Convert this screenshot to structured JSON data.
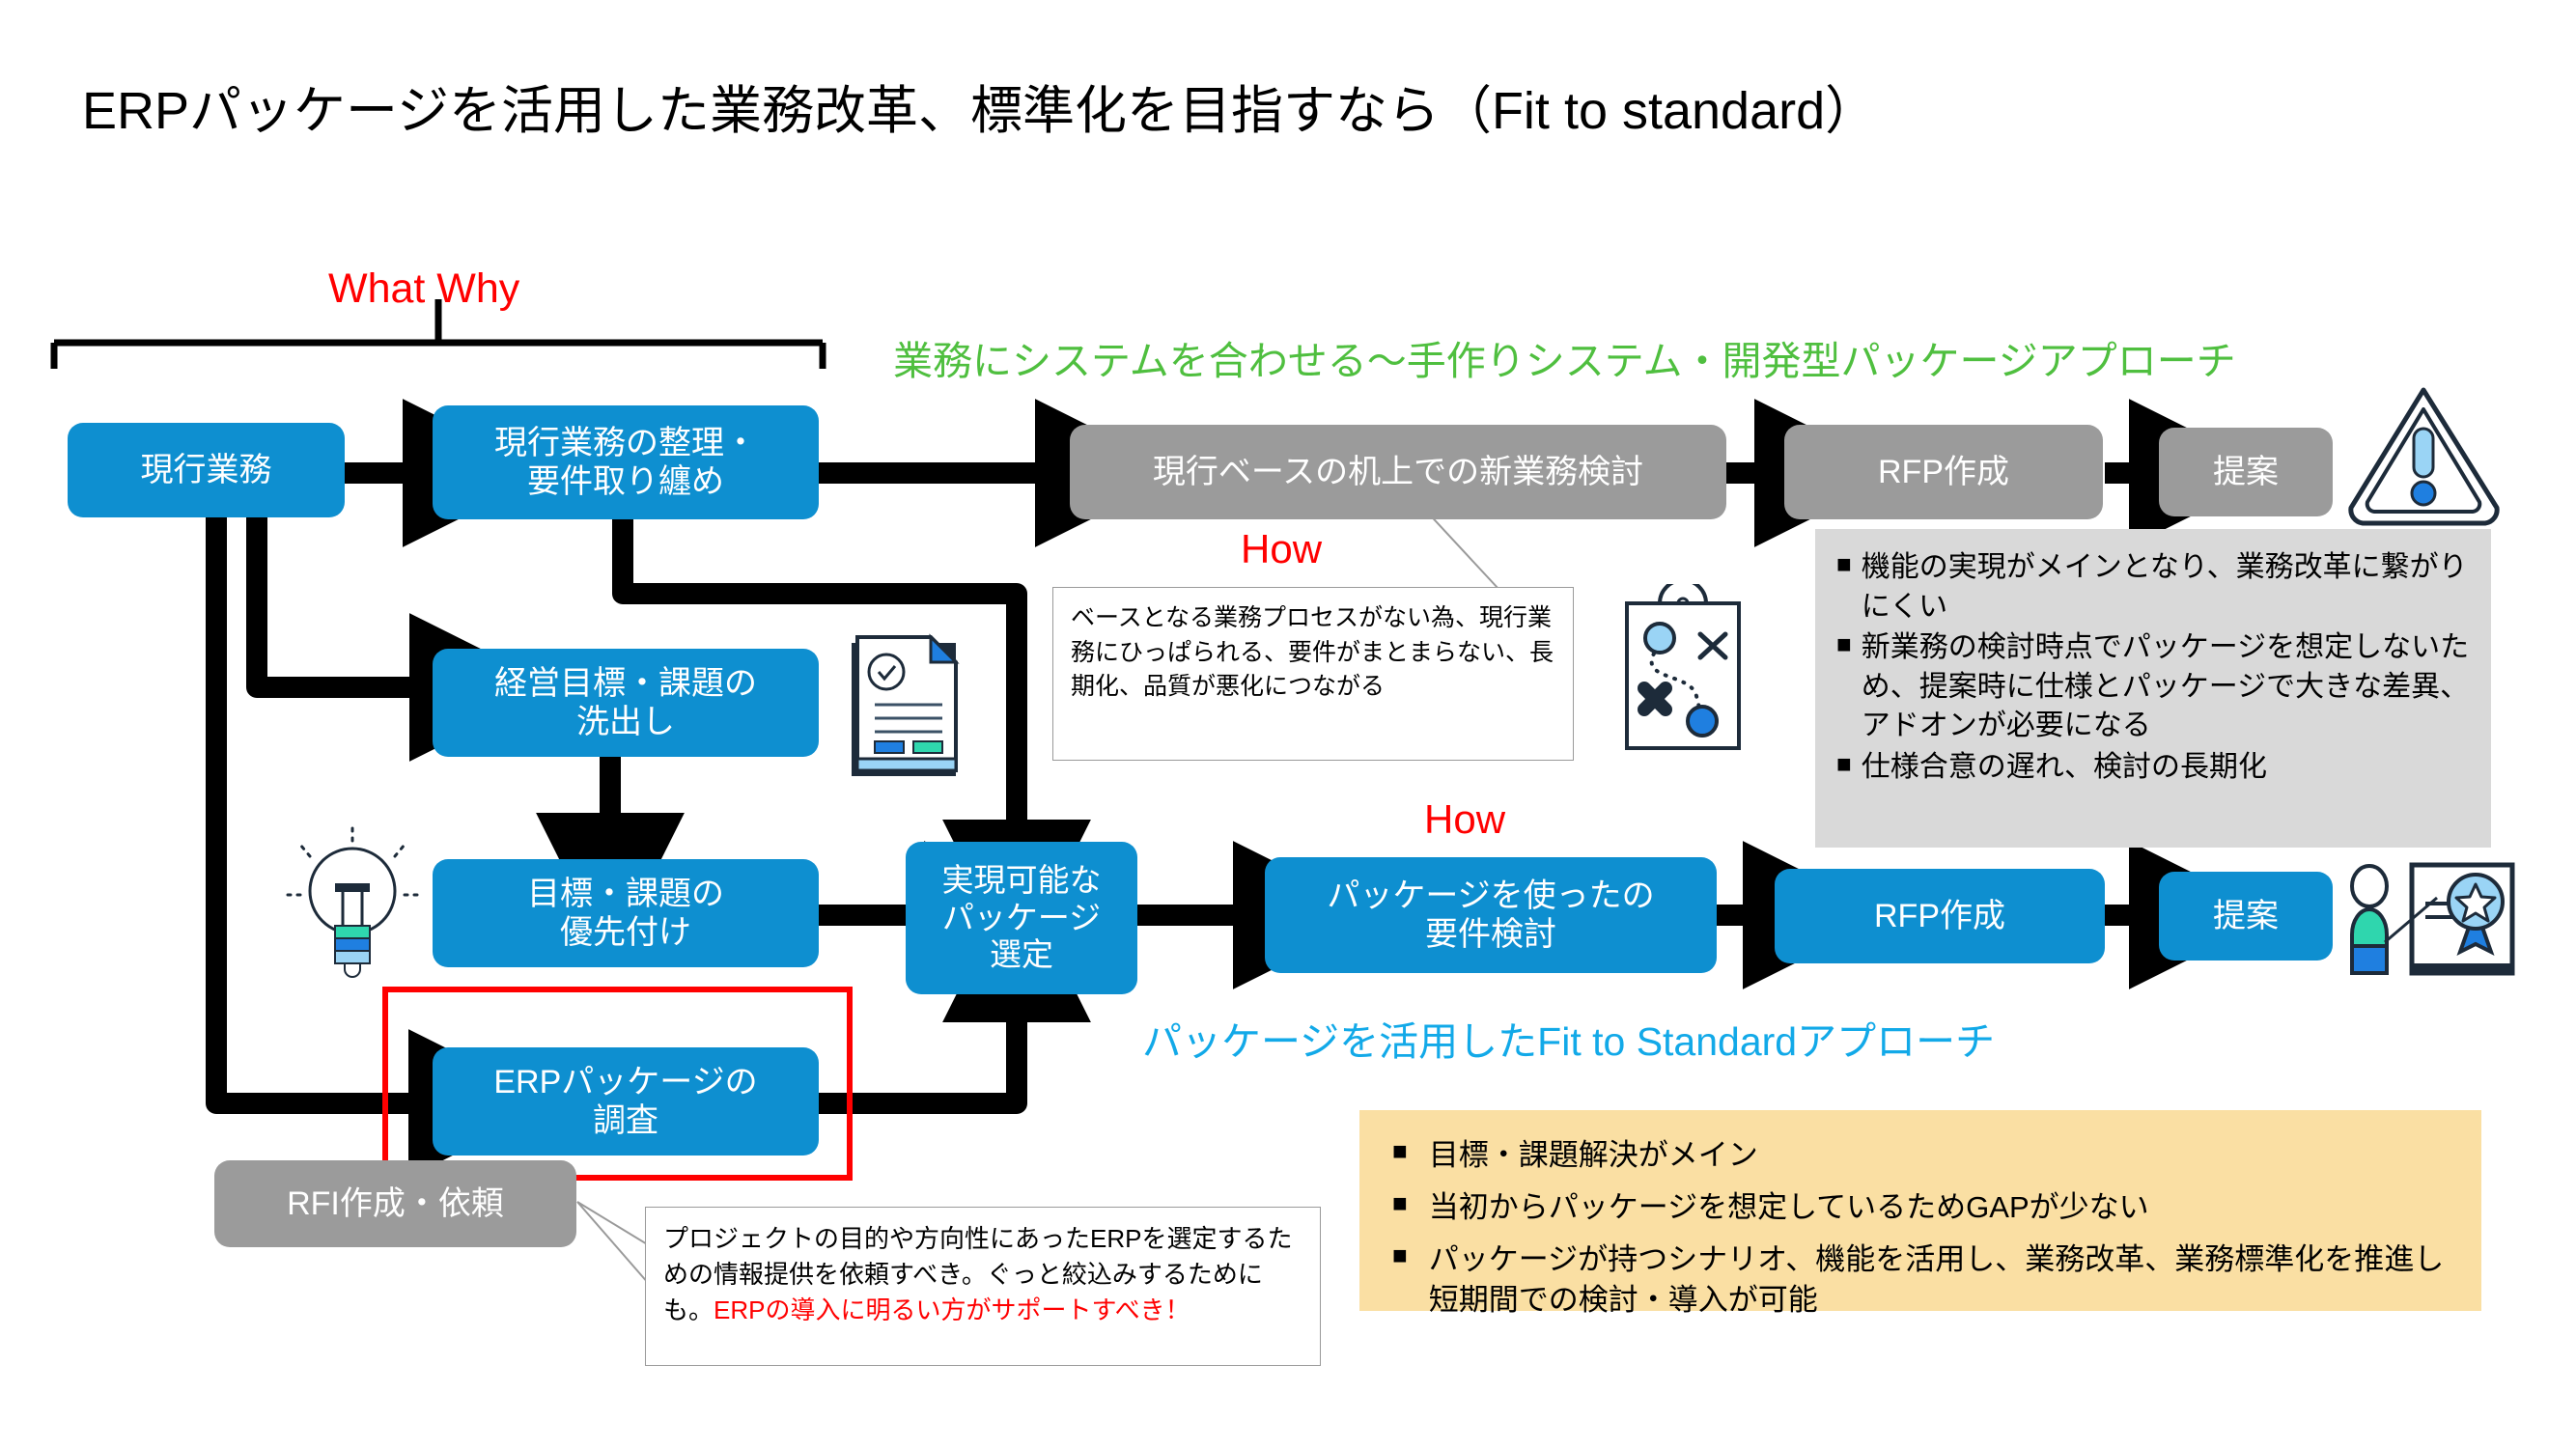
{
  "title": "ERPパッケージを活用した業務改革、標準化を目指すなら（Fit to standard）",
  "labels": {
    "what_why": "What Why",
    "how_top": "How",
    "how_mid": "How"
  },
  "headings": {
    "green_approach": "業務にシステムを合わせる〜手作りシステム・開発型パッケージアプローチ",
    "cyan_approach": "パッケージを活用したFit to Standardアプローチ"
  },
  "boxes": {
    "current_ops": "現行業務",
    "organize_requirements": "現行業務の整理・\n要件取り纏め",
    "mgmt_goals": "経営目標・課題の\n洗出し",
    "prioritize": "目標・課題の\n優先付け",
    "erp_survey": "ERPパッケージの\n調査",
    "feasible_package": "実現可能な\nパッケージ\n選定",
    "desk_study": "現行ベースの机上での新業務検討",
    "rfp_top": "RFP作成",
    "proposal_top": "提案",
    "package_requirements": "パッケージを使ったの\n要件検討",
    "rfp_bottom": "RFP作成",
    "proposal_bottom": "提案",
    "rfi": "RFI作成・依頼"
  },
  "callouts": {
    "desk_study_note": "ベースとなる業務プロセスがない為、現行業務にひっぱられる、要件がまとまらない、長期化、品質が悪化につながる",
    "rfi_note_black": "プロジェクトの目的や方向性にあったERPを選定するための情報提供を依頼すべき。ぐっと絞込みするためにも。",
    "rfi_note_red": "ERPの導入に明るい方がサポートすべき！"
  },
  "panel_gray": {
    "bullet": "■",
    "items": [
      "機能の実現がメインとなり、業務改革に繋がりにくい",
      "新業務の検討時点でパッケージを想定しないため、提案時に仕様とパッケージで大きな差異、アドオンが必要になる",
      "仕様合意の遅れ、検討の長期化"
    ]
  },
  "panel_orange": {
    "bullet": "■",
    "items": [
      "目標・課題解決がメイン",
      "当初からパッケージを想定しているためGAPが少ない",
      "パッケージが持つシナリオ、機能を活用し、業務改革、業務標準化を推進し短期間での検討・導入が可能"
    ]
  },
  "icons": {
    "document": "document-check-icon",
    "lightbulb": "lightbulb-icon",
    "route_map": "route-map-icon",
    "warning": "warning-triangle-icon",
    "award": "award-certificate-icon"
  },
  "colors": {
    "blue_box": "#0e8fd0",
    "gray_box": "#9b9b9b",
    "green_text": "#4fbf3f",
    "cyan_text": "#12a9e8",
    "red_accent": "#ff0000",
    "orange_panel": "#fadfa3",
    "gray_panel": "#d9d9d9"
  }
}
